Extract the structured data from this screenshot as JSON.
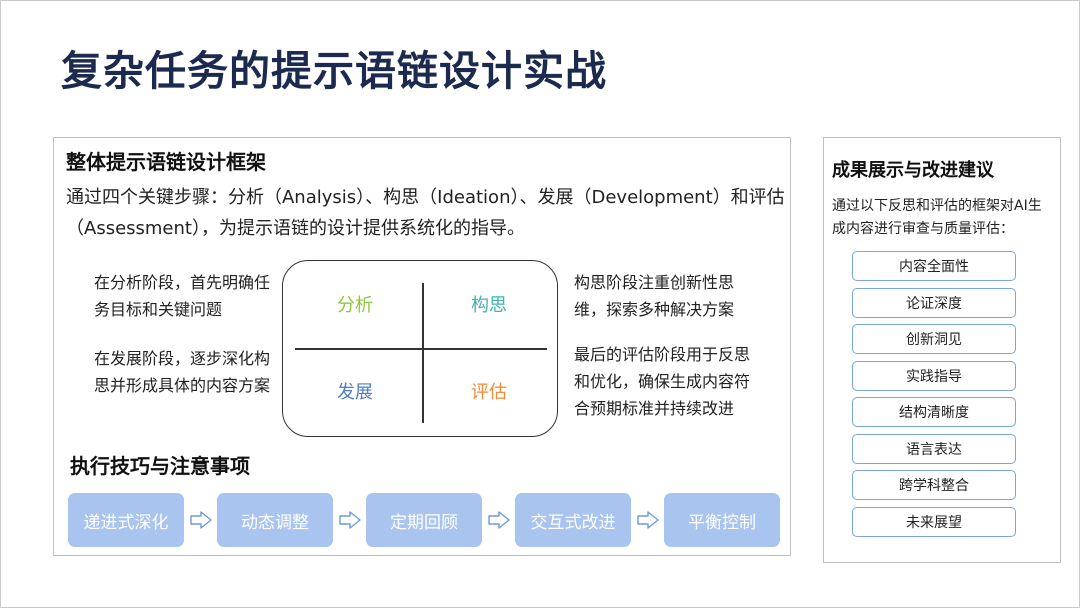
{
  "title": "复杂任务的提示语链设计实战",
  "framework": {
    "heading": "整体提示语链设计框架",
    "intro": "通过四个关键步骤：分析（Analysis）、构思（Ideation）、发展（Development）和评估（Assessment），为提示语链的设计提供系统化的指导。",
    "notes": {
      "analysis": "在分析阶段，首先明确任务目标和关键问题",
      "ideation": "构思阶段注重创新性思维，探索多种解决方案",
      "development": "在发展阶段，逐步深化构思并形成具体的内容方案",
      "assessment": "最后的评估阶段用于反思和优化，确保生成内容符合预期标准并持续改进"
    },
    "matrix": {
      "analysis": {
        "label": "分析",
        "color": "#8dc63f"
      },
      "ideation": {
        "label": "构思",
        "color": "#3fb5a9"
      },
      "development": {
        "label": "发展",
        "color": "#4f7ec0"
      },
      "assessment": {
        "label": "评估",
        "color": "#f28c38"
      }
    }
  },
  "execution": {
    "heading": "执行技巧与注意事项",
    "steps": [
      "递进式深化",
      "动态调整",
      "定期回顾",
      "交互式改进",
      "平衡控制"
    ],
    "arrow_icon": "right-arrow-outline-icon"
  },
  "sidebar": {
    "heading": "成果展示与改进建议",
    "description": "通过以下反思和评估的框架对AI生成内容进行审查与质量评估：",
    "items": [
      "内容全面性",
      "论证深度",
      "创新洞见",
      "实践指导",
      "结构清晰度",
      "语言表达",
      "跨学科整合",
      "未来展望"
    ]
  },
  "colors": {
    "title": "#1b2a4e",
    "step_fill": "#a9c4ee",
    "item_border": "#7aa6dd"
  }
}
